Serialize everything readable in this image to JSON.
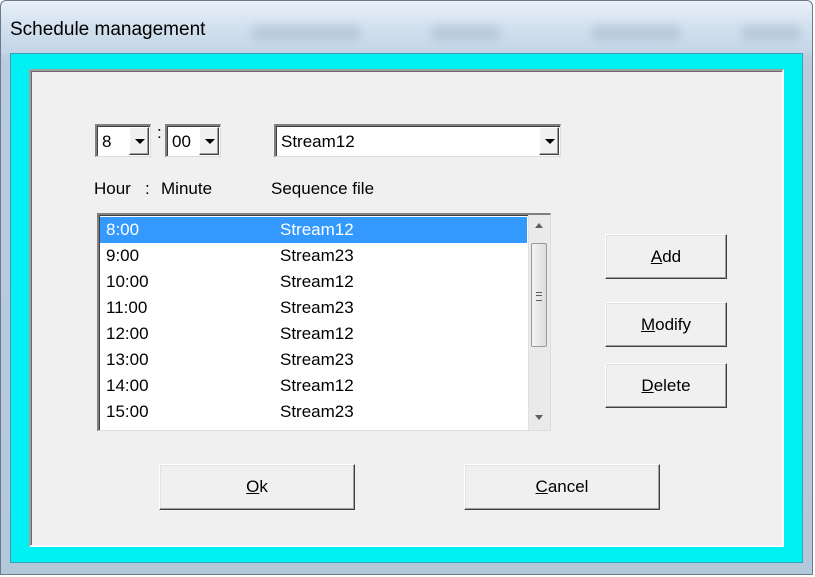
{
  "window": {
    "title": "Schedule management"
  },
  "time": {
    "hour": "8",
    "minute": "00",
    "separator": ":",
    "sequence_file": "Stream12"
  },
  "labels": {
    "hour": "Hour",
    "separator": ":",
    "minute": "Minute",
    "sequence_file": "Sequence file"
  },
  "schedule": {
    "items": [
      {
        "time": "8:00",
        "file": "Stream12",
        "selected": true
      },
      {
        "time": "9:00",
        "file": "Stream23",
        "selected": false
      },
      {
        "time": "10:00",
        "file": "Stream12",
        "selected": false
      },
      {
        "time": "11:00",
        "file": "Stream23",
        "selected": false
      },
      {
        "time": "12:00",
        "file": "Stream12",
        "selected": false
      },
      {
        "time": "13:00",
        "file": "Stream23",
        "selected": false
      },
      {
        "time": "14:00",
        "file": "Stream12",
        "selected": false
      },
      {
        "time": "15:00",
        "file": "Stream23",
        "selected": false
      }
    ]
  },
  "buttons": {
    "add": {
      "mnemonic": "A",
      "rest": "dd"
    },
    "modify": {
      "mnemonic": "M",
      "rest": "odify"
    },
    "delete": {
      "mnemonic": "D",
      "rest": "elete"
    },
    "ok": {
      "mnemonic": "O",
      "rest": "k"
    },
    "cancel": {
      "mnemonic": "C",
      "rest": "ancel"
    }
  },
  "colors": {
    "frame_accent": "#00f0f4",
    "selection": "#3399ff",
    "dialog_face": "#f0f0f0"
  },
  "icons": [
    "chevron-down-icon",
    "scroll-up-icon",
    "scroll-down-icon",
    "scroll-grip-icon"
  ]
}
